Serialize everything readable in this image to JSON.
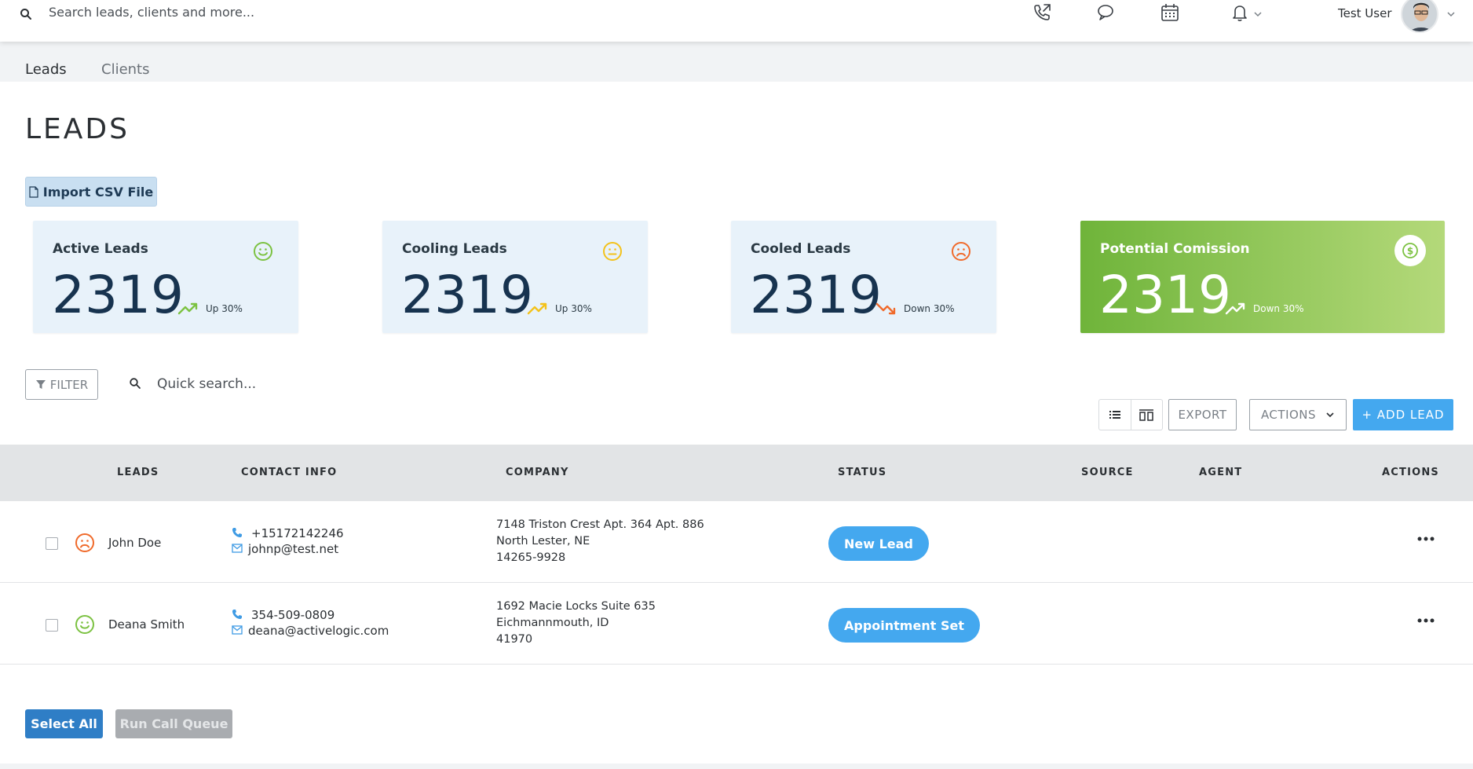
{
  "topbar": {
    "search_placeholder": "Search leads, clients and more...",
    "icons": [
      "search-icon",
      "phone-call-icon",
      "chat-icon",
      "calendar-icon",
      "bell-icon",
      "chevron-down-icon"
    ],
    "user_name": "Test User"
  },
  "tabs": [
    {
      "label": "Leads",
      "active": true
    },
    {
      "label": "Clients",
      "active": false
    }
  ],
  "page": {
    "title": "LEADS",
    "import_label": "Import CSV File"
  },
  "cards": [
    {
      "title": "Active Leads",
      "value": "2319",
      "trend": "Up 30%",
      "trend_dir": "up",
      "face": "happy",
      "color": "#7cc242"
    },
    {
      "title": "Cooling Leads",
      "value": "2319",
      "trend": "Up 30%",
      "trend_dir": "up",
      "face": "neutral",
      "color": "#f3c21b"
    },
    {
      "title": "Cooled Leads",
      "value": "2319",
      "trend": "Down 30%",
      "trend_dir": "down",
      "face": "sad",
      "color": "#f06a2b"
    },
    {
      "title": "Potential Comission",
      "value": "2319",
      "trend": "Down 30%",
      "trend_dir": "up",
      "face": "dollar",
      "color": "#ffffff"
    }
  ],
  "toolbar": {
    "filter_label": "FILTER",
    "quick_search_placeholder": "Quick search...",
    "export_label": "EXPORT",
    "actions_label": "ACTIONS",
    "add_label": "+ ADD LEAD"
  },
  "table": {
    "columns": [
      "LEADS",
      "CONTACT INFO",
      "COMPANY",
      "STATUS",
      "SOURCE",
      "AGENT",
      "ACTIONS"
    ],
    "rows": [
      {
        "face": "sad",
        "name": "John Doe",
        "phone": "+15172142246",
        "email": "johnp@test.net",
        "address": [
          "7148 Triston Crest Apt. 364 Apt. 886",
          "North Lester, NE",
          "14265-9928"
        ],
        "status": "New Lead",
        "source": "",
        "agent": ""
      },
      {
        "face": "happy",
        "name": "Deana Smith",
        "phone": "354-509-0809",
        "email": "deana@activelogic.com",
        "address": [
          "1692 Macie Locks Suite 635",
          "Eichmannmouth, ID",
          "41970"
        ],
        "status": "Appointment Set",
        "source": "",
        "agent": ""
      }
    ]
  },
  "footer": {
    "select_all_label": "Select All",
    "run_queue_label": "Run Call Queue"
  },
  "colors": {
    "accent": "#44a8ef",
    "primary_dark": "#2f7ec6",
    "happy": "#7cc242",
    "neutral": "#f3c21b",
    "sad": "#f06a2b"
  }
}
